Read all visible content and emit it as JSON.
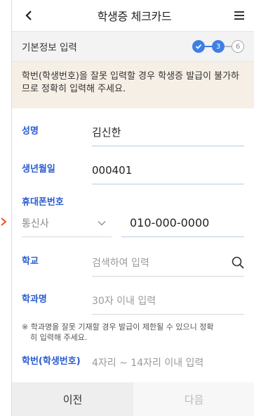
{
  "header": {
    "title": "학생증 체크카드"
  },
  "stepbar": {
    "title": "기본정보 입력",
    "current_step": "3",
    "last_step": "6"
  },
  "notice": "학번(학생번호)을 잘못 입력할 경우 학생증 발급이 불가하므로 정확히 입력해 주세요.",
  "form": {
    "name": {
      "label": "성명",
      "value": "김신한"
    },
    "birth": {
      "label": "생년월일",
      "value": "000401"
    },
    "phone": {
      "label": "휴대폰번호",
      "carrier_placeholder": "통신사",
      "number": "010-000-0000"
    },
    "school": {
      "label": "학교",
      "placeholder": "검색하여 입력"
    },
    "major": {
      "label": "학과명",
      "placeholder": "30자 이내 입력"
    },
    "major_hint_line1": "※ 학과명을 잘못 기재할 경우 발급이 제한될 수 있으니 정확",
    "major_hint_line2": "히 입력해 주세요.",
    "student_id": {
      "label": "학번(학생번호)",
      "placeholder": "4자리 ~ 14자리 이내 입력"
    }
  },
  "footer": {
    "prev_label": "이전",
    "next_label": "다음"
  },
  "colors": {
    "accent": "#3e7ee6",
    "label_blue": "#2c5ccf",
    "notice_bg": "#f6efe5",
    "side_arrow": "#e8541e"
  }
}
